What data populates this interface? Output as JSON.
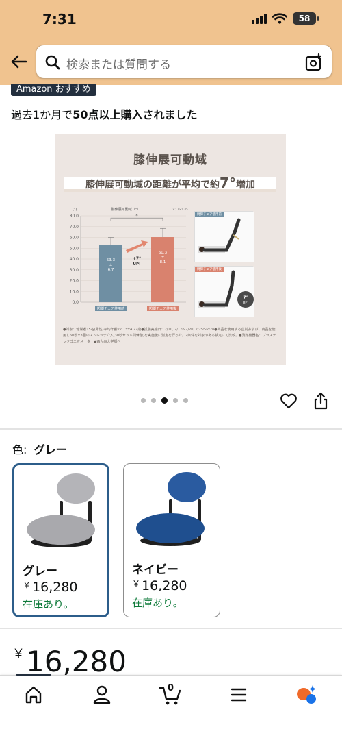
{
  "status_bar": {
    "time": "7:31",
    "battery": "58"
  },
  "search": {
    "placeholder": "検索または質問する"
  },
  "badge": {
    "label": "Amazon おすすめ"
  },
  "purchase_info": {
    "prefix": "過去1か月で",
    "highlight": "50点以上購入されました"
  },
  "product_image": {
    "title": "膝伸展可動域",
    "subtitle_prefix": "膝伸展可動域の距離が平均で約",
    "subtitle_value": "7°",
    "subtitle_suffix": "増加",
    "chart_title": "膝伸展可動域（°）",
    "significance_note": "＊：P<0.05",
    "increase_label_1": "+7°",
    "increase_label_2": "UP!",
    "badge_line_1": "7°",
    "badge_line_2": "UP!",
    "photo_label_before": "閃脚チェア使用前",
    "photo_label_after": "閃脚チェア使用後",
    "footnote": "●対象：健常者15名(男性)平均年齢22.13±4.27歳●試験実施日：2/10, 2/17〜2/20, 2/25〜2/28●商品を使用する直前および、商品を使用し60秒×3回のストレッチ介入(30秒セット間休憩)を実施後に測定を行った。2条件を対象のある検定にて比較。●測定機器名：プラスチックゴニオメーター●西九州大学調べ"
  },
  "chart_data": {
    "type": "bar",
    "title": "膝伸展可動域（°）",
    "ylabel": "(°)",
    "categories": [
      "閃脚チェア使用前",
      "閃脚チェア使用後"
    ],
    "values": [
      53.3,
      60.3
    ],
    "errors": [
      6.7,
      8.1
    ],
    "value_labels": [
      "53.3 ± 6.7",
      "60.3 ± 8.1"
    ],
    "ylim": [
      0,
      80
    ],
    "yticks": [
      "0.0",
      "10.0",
      "20.0",
      "30.0",
      "40.0",
      "50.0",
      "60.0",
      "70.0",
      "80.0"
    ],
    "colors": [
      "#6f8fa3",
      "#d9826e"
    ],
    "annotation": "*"
  },
  "carousel": {
    "total": 5,
    "active_index": 2
  },
  "variation": {
    "label": "色:",
    "selected": "グレー",
    "options": [
      {
        "name": "グレー",
        "yen": "￥",
        "price": "16,280",
        "stock": "在庫あり。",
        "seat_color": "#a9a9ad",
        "back_color": "#b4b4b8"
      },
      {
        "name": "ネイビー",
        "yen": "￥",
        "price": "16,280",
        "stock": "在庫あり。",
        "seat_color": "#1f4f8f",
        "back_color": "#2a5ba0"
      }
    ]
  },
  "price": {
    "yen": "￥",
    "value": "16,280"
  },
  "bottom_nav": {
    "cart_count": "0"
  },
  "colors": {
    "header_bg": "#f0c38f",
    "in_stock": "#0e7a3a",
    "selected_border": "#2c5d8a"
  }
}
